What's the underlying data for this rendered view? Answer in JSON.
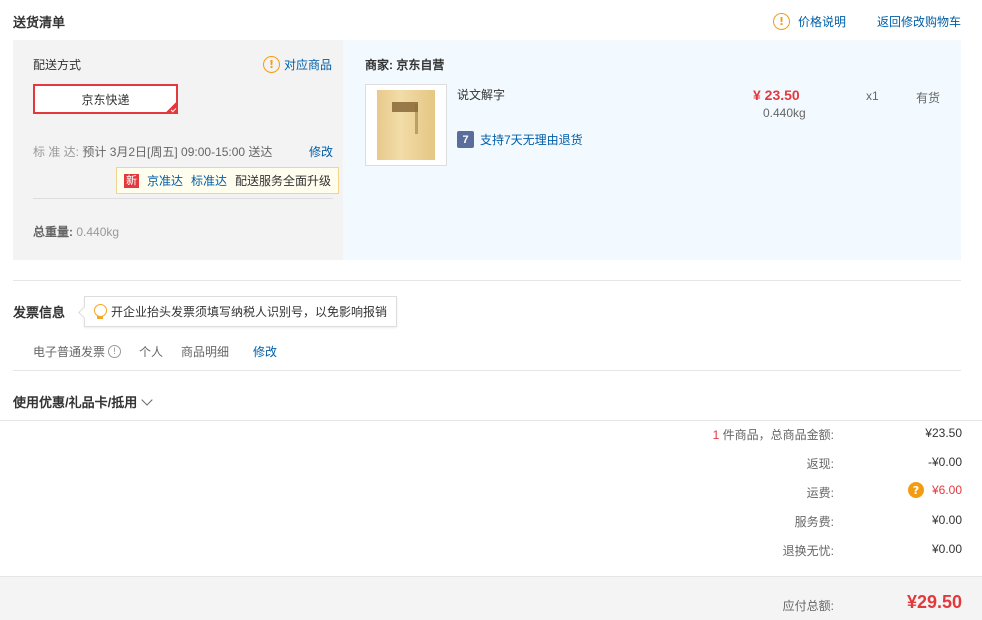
{
  "header": {
    "title": "送货清单",
    "price_note": "价格说明",
    "price_note_icon": "!",
    "return_cart": "返回修改购物车"
  },
  "delivery": {
    "label": "配送方式",
    "match_goods": "对应商品",
    "selected_option": "京东快递",
    "standard_label": "标 准 达:",
    "standard_value": "预计 3月2日[周五] 09:00-15:00 送达",
    "modify": "修改",
    "upgrade_badge": "新",
    "upgrade_link_1": "京准达",
    "upgrade_link_2": "标准达",
    "upgrade_text": "配送服务全面升级",
    "total_weight_label": "总重量:",
    "total_weight_value": "0.440kg"
  },
  "merchant": {
    "label": "商家: 京东自营"
  },
  "product": {
    "name": "说文解字",
    "price": "¥ 23.50",
    "weight": "0.440kg",
    "qty": "x1",
    "stock": "有货",
    "return_badge": "7",
    "return_policy": "支持7天无理由退货"
  },
  "invoice": {
    "title": "发票信息",
    "tip": "开企业抬头发票须填写纳税人识别号，以免影响报销",
    "type": "电子普通发票",
    "info_icon": "!",
    "person": "个人",
    "detail": "商品明细",
    "modify": "修改"
  },
  "coupon": {
    "label": "使用优惠/礼品卡/抵用"
  },
  "summary": {
    "count_num": "1",
    "count_label": " 件商品，总商品金额:",
    "goods_total": "¥23.50",
    "cashback_label": "返现:",
    "cashback": "-¥0.00",
    "shipping_label": "运费:",
    "shipping_icon": "?",
    "shipping": "¥6.00",
    "service_label": "服务费:",
    "service": "¥0.00",
    "return_label": "退换无忧:",
    "return_fee": "¥0.00",
    "total_label": "应付总额:",
    "total": "¥29.50"
  },
  "colors": {
    "accent_red": "#e4393c",
    "link_blue": "#005ea7",
    "warning_orange": "#f39c12"
  }
}
